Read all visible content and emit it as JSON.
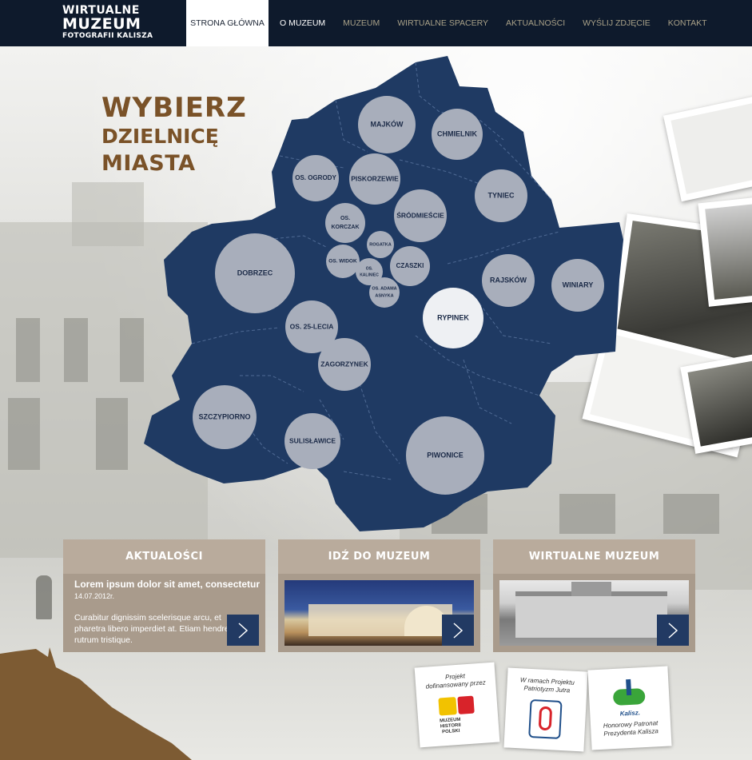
{
  "logo": {
    "line1": "WIRTUALNE",
    "line2": "MUZEUM",
    "line3": "FOTOGRAFII KALISZA"
  },
  "nav": {
    "items": [
      {
        "label": "STRONA GŁÓWNA"
      },
      {
        "label": "O MUZEUM"
      },
      {
        "label": "MUZEUM"
      },
      {
        "label": "WIRTUALNE SPACERY"
      },
      {
        "label": "AKTUALNOŚCI"
      },
      {
        "label": "WYŚLIJ ZDJĘCIE"
      },
      {
        "label": "KONTAKT"
      }
    ]
  },
  "headline": {
    "line1": "WYBIERZ",
    "line2": "DZIELNICĘ",
    "line3": "MIASTA"
  },
  "districts": [
    {
      "label": "MAJKÓW"
    },
    {
      "label": "CHMIELNIK"
    },
    {
      "label": "OS. OGRODY"
    },
    {
      "label": "PISKORZEWIE"
    },
    {
      "label": "TYNIEC"
    },
    {
      "label": "ŚRÓDMIEŚCIE"
    },
    {
      "label": "OS."
    },
    {
      "label": "KORCZAK"
    },
    {
      "label": "ROGATKA"
    },
    {
      "label": "DOBRZEC"
    },
    {
      "label": "OS. WIDOK"
    },
    {
      "label": "CZASZKI"
    },
    {
      "label": "OS."
    },
    {
      "label": "KALINIEC"
    },
    {
      "label": "OS. ADAMA"
    },
    {
      "label": "ASNYKA"
    },
    {
      "label": "RAJSKÓW"
    },
    {
      "label": "WINIARY"
    },
    {
      "label": "RYPINEK"
    },
    {
      "label": "OS. 25-LECIA"
    },
    {
      "label": "ZAGORZYNEK"
    },
    {
      "label": "SZCZYPIORNO"
    },
    {
      "label": "SULISŁAWICE"
    },
    {
      "label": "PIWONICE"
    }
  ],
  "cards": {
    "news": {
      "title": "AKTUALOŚCI",
      "headline": "Lorem ipsum dolor sit amet, consectetur",
      "date": "14.07.2012r.",
      "text": "Curabitur dignissim scelerisque arcu, et pharetra libero imperdiet at. Etiam hendrerit rutrum tristique."
    },
    "museum": {
      "title": "IDŹ DO MUZEUM"
    },
    "virtual": {
      "title": "WIRTUALNE MUZEUM"
    }
  },
  "sponsors": [
    {
      "text_line1": "Projekt",
      "text_line2": "dofinansowany przez",
      "logo_text": "MUZEUM HISTORII POLSKI"
    },
    {
      "text_line1": "W ramach Projektu",
      "text_line2": "Patriotyzm Jutra"
    },
    {
      "text_line1": "Honorowy Patronat",
      "text_line2": "Prezydenta Kalisza",
      "logo_text": "Kalisz."
    }
  ],
  "colors": {
    "header": "#0e1a2c",
    "map": "#1f3a63",
    "accent_brown": "#7a5228",
    "card": "#b9ab9c",
    "arrow": "#223a63",
    "circle": "#a8aebb",
    "circle_active": "#eef0f3"
  },
  "icons": {
    "arrow": "chevron-right-icon"
  }
}
